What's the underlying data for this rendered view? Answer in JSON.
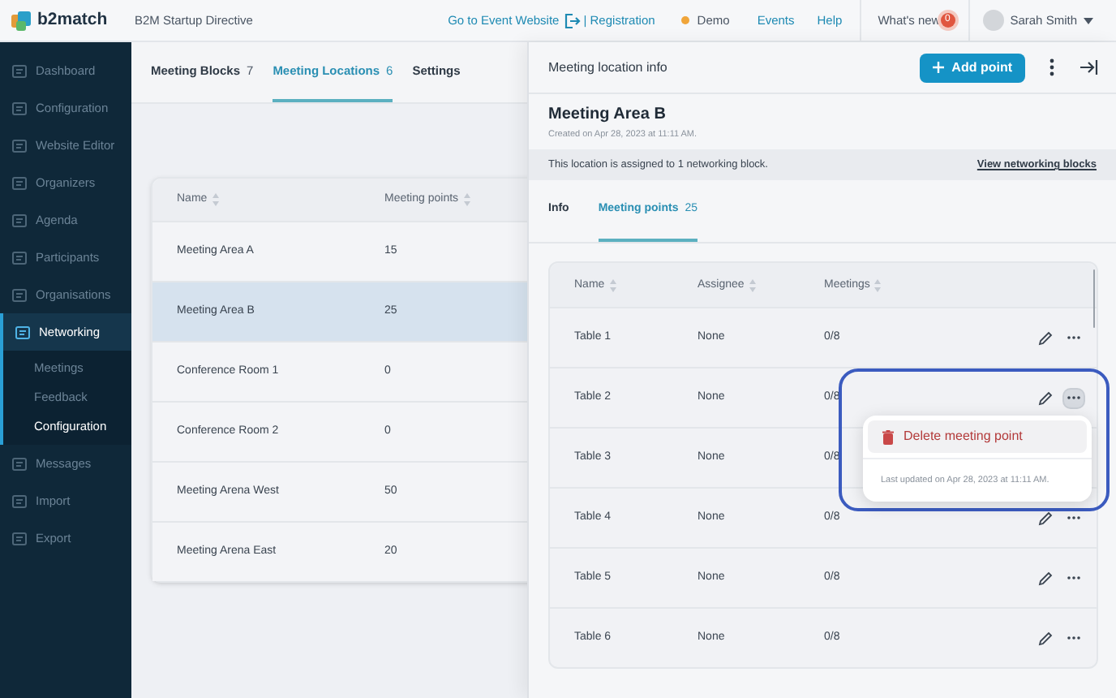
{
  "header": {
    "logo_text": "b2match",
    "event_name": "B2M Startup Directive",
    "nav": [
      {
        "kind": "link",
        "label": "Go to Event Website"
      },
      {
        "kind": "icon-link",
        "label": "| Registration"
      },
      {
        "kind": "status",
        "label": "Demo",
        "color": "#f0a53a"
      },
      {
        "kind": "link",
        "label": "Events"
      },
      {
        "kind": "link",
        "label": "Help"
      },
      {
        "kind": "badge",
        "label": "What's new",
        "badge": "0"
      }
    ],
    "user": {
      "name": "Sarah Smith"
    }
  },
  "sidebar": {
    "items": [
      {
        "label": "Dashboard",
        "selected": false
      },
      {
        "label": "Configuration",
        "selected": false
      },
      {
        "label": "Website Editor",
        "selected": false
      },
      {
        "label": "Organizers",
        "selected": false
      },
      {
        "label": "Agenda",
        "selected": false
      },
      {
        "label": "Participants",
        "selected": false
      },
      {
        "label": "Organisations",
        "selected": false
      },
      {
        "label": "Networking",
        "selected": true,
        "expanded": true,
        "children": [
          {
            "label": "Meetings",
            "selected": false
          },
          {
            "label": "Feedback",
            "selected": false
          },
          {
            "label": "Configuration",
            "selected": true
          }
        ]
      },
      {
        "label": "Messages",
        "selected": false
      },
      {
        "label": "Import",
        "selected": false
      },
      {
        "label": "Export",
        "selected": false
      }
    ]
  },
  "main": {
    "tabs": [
      {
        "label": "Meeting Blocks",
        "count": "7",
        "selected": false
      },
      {
        "label": "Meeting Locations",
        "count": "6",
        "selected": true
      },
      {
        "label": "Settings",
        "selected": false
      }
    ],
    "table": {
      "columns": [
        "Name",
        "Meeting points"
      ],
      "rows": [
        {
          "cells": [
            "Meeting Area A",
            "15"
          ],
          "selected": false
        },
        {
          "cells": [
            "Meeting Area B",
            "25"
          ],
          "selected": true
        },
        {
          "cells": [
            "Conference Room 1",
            "0"
          ],
          "selected": false
        },
        {
          "cells": [
            "Conference Room 2",
            "0"
          ],
          "selected": false
        },
        {
          "cells": [
            "Meeting Arena West",
            "50"
          ],
          "selected": false
        },
        {
          "cells": [
            "Meeting Arena East",
            "20"
          ],
          "selected": false
        }
      ]
    }
  },
  "panel": {
    "title": "Meeting location info",
    "add_button": "Add point",
    "name": "Meeting Area B",
    "created": "Created on Apr 28, 2023 at 11:11 AM.",
    "notice": "This location is assigned to 1 networking block.",
    "notice_link": "View networking blocks",
    "tabs": [
      {
        "label": "Info",
        "selected": false
      },
      {
        "label": "Meeting points",
        "count": "25",
        "selected": true
      }
    ],
    "table": {
      "columns": [
        "Name",
        "Assignee",
        "Meetings"
      ],
      "rows": [
        {
          "cells": [
            "Table 1",
            "None",
            "0/8"
          ],
          "menu_open": false
        },
        {
          "cells": [
            "Table 2",
            "None",
            "0/8"
          ],
          "menu_open": true
        },
        {
          "cells": [
            "Table 3",
            "None",
            "0/8"
          ],
          "menu_open": false
        },
        {
          "cells": [
            "Table 4",
            "None",
            "0/8"
          ],
          "menu_open": false
        },
        {
          "cells": [
            "Table 5",
            "None",
            "0/8"
          ],
          "menu_open": false
        },
        {
          "cells": [
            "Table 6",
            "None",
            "0/8"
          ],
          "menu_open": false
        }
      ]
    },
    "menu": {
      "items": [
        "Delete meeting point"
      ],
      "footer": "Last updated on Apr 28, 2023 at 11:11 AM."
    }
  }
}
